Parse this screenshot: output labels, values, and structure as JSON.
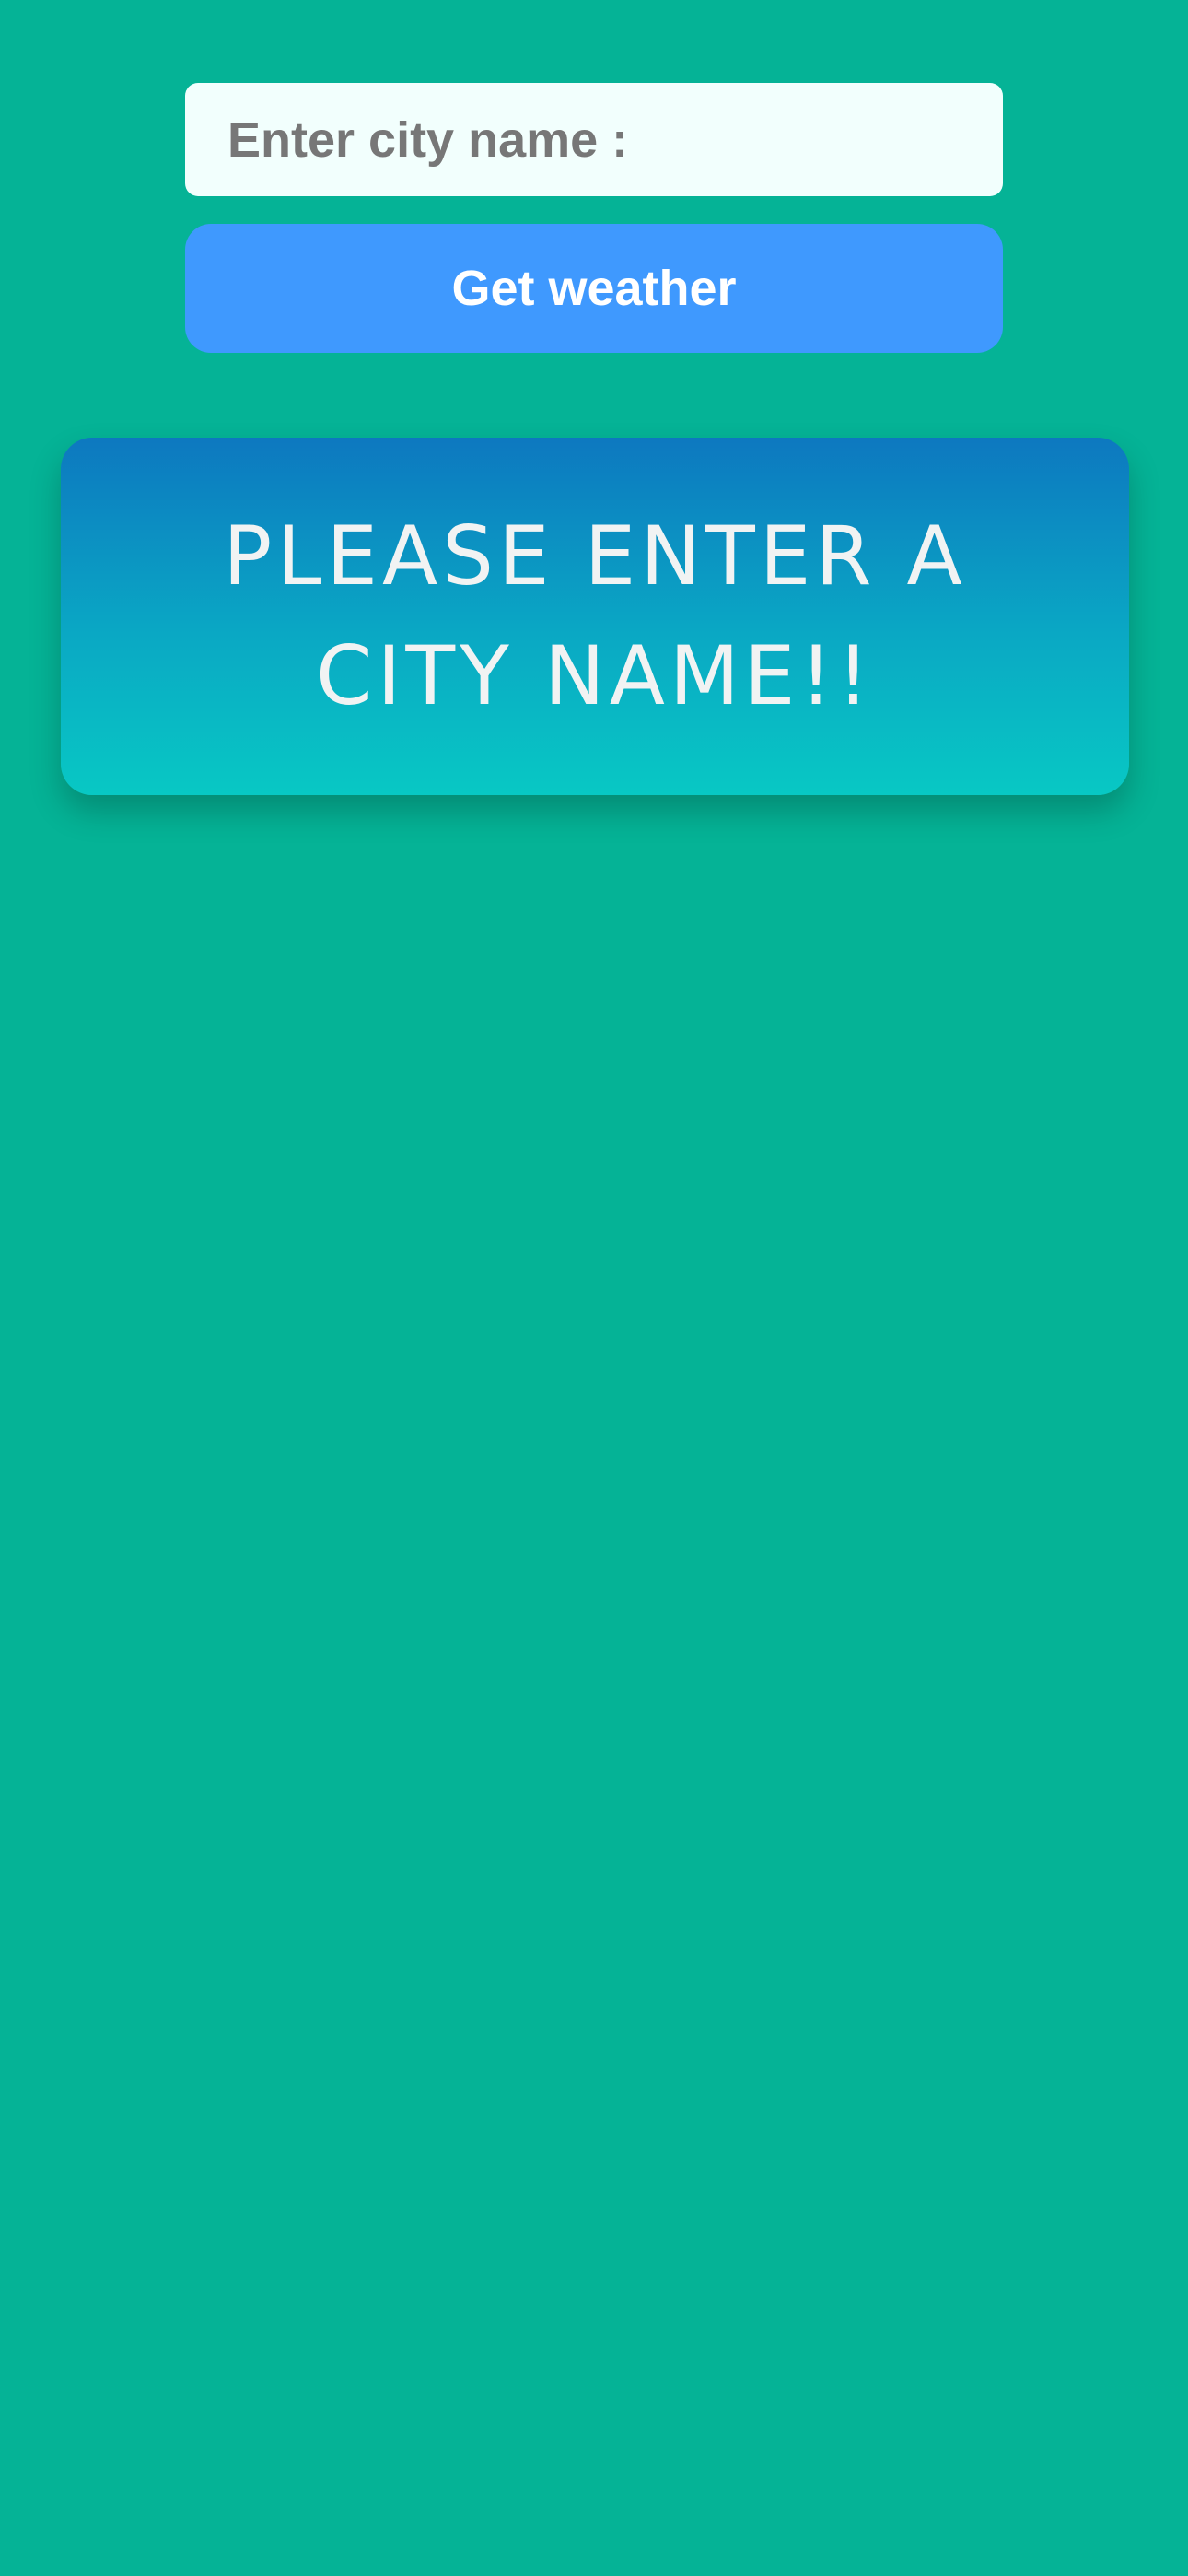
{
  "search": {
    "placeholder": "Enter city name :",
    "value": ""
  },
  "button": {
    "label": "Get weather"
  },
  "message": {
    "text": "PLEASE ENTER A CITY NAME!!"
  },
  "colors": {
    "background": "#05b396",
    "input_background": "#f2fffd",
    "placeholder_text": "#777777",
    "button_background": "#3f99fe",
    "button_text": "#ffffff",
    "card_gradient_top": "#0d78c0",
    "card_gradient_bottom": "#08c8c4",
    "card_text": "#f1f3f3"
  }
}
